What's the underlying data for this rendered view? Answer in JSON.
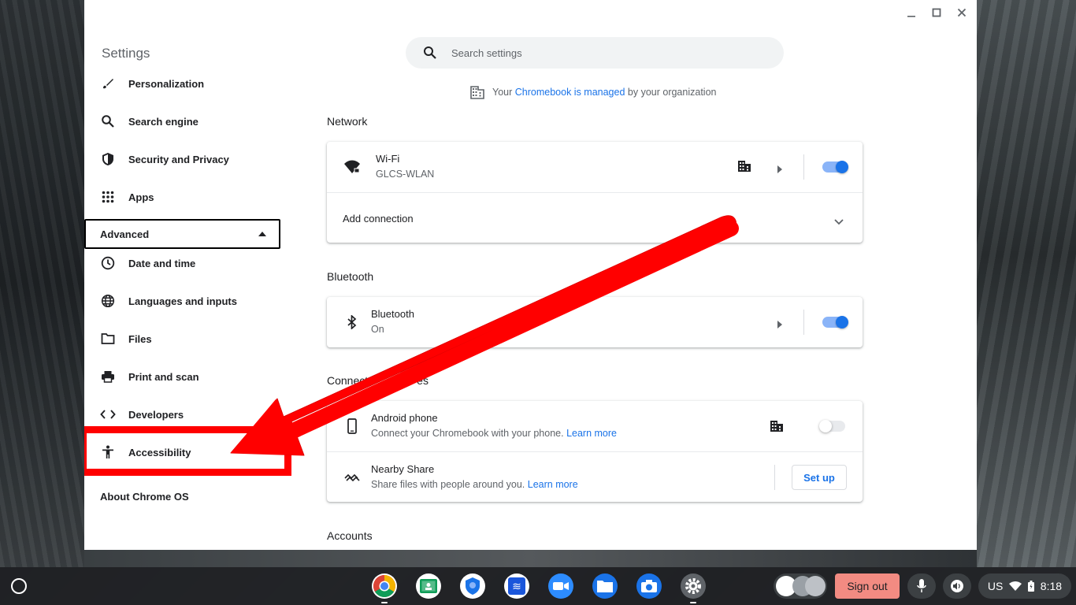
{
  "window": {
    "minimize_label": "–",
    "maximize_label": "□",
    "close_label": "×"
  },
  "sidebar": {
    "title": "Settings",
    "items": [
      {
        "label": "Personalization",
        "icon": "brush-icon"
      },
      {
        "label": "Search engine",
        "icon": "search-icon"
      },
      {
        "label": "Security and Privacy",
        "icon": "shield-icon"
      },
      {
        "label": "Apps",
        "icon": "apps-grid-icon"
      }
    ],
    "advanced_label": "Advanced",
    "advanced_items": [
      {
        "label": "Date and time",
        "icon": "clock-icon"
      },
      {
        "label": "Languages and inputs",
        "icon": "globe-icon"
      },
      {
        "label": "Files",
        "icon": "folder-icon"
      },
      {
        "label": "Print and scan",
        "icon": "printer-icon"
      },
      {
        "label": "Developers",
        "icon": "code-icon"
      },
      {
        "label": "Accessibility",
        "icon": "accessibility-icon"
      }
    ],
    "about_label": "About Chrome OS"
  },
  "search": {
    "placeholder": "Search settings"
  },
  "managed": {
    "prefix": "Your",
    "link": "Chromebook is managed",
    "suffix": "by your organization"
  },
  "network": {
    "section_title": "Network",
    "wifi_label": "Wi-Fi",
    "wifi_network": "GLCS-WLAN",
    "wifi_enabled": true,
    "add_connection_label": "Add connection"
  },
  "bluetooth": {
    "section_title": "Bluetooth",
    "label": "Bluetooth",
    "status": "On",
    "enabled": true
  },
  "connected_devices": {
    "section_title_visible": "Connect",
    "section_title_tail": "es",
    "android_label": "Android phone",
    "android_desc": "Connect your Chromebook with your phone.",
    "android_link": "Learn more",
    "android_enabled": false,
    "nearby_label": "Nearby Share",
    "nearby_desc": "Share files with people around you.",
    "nearby_link": "Learn more",
    "setup_label": "Set up"
  },
  "accounts": {
    "section_title": "Accounts"
  },
  "shelf": {
    "sign_out_label": "Sign out",
    "locale": "US",
    "time": "8:18",
    "apps": [
      "chrome-icon",
      "classroom-icon",
      "security-app-icon",
      "docs-app-icon",
      "zoom-icon",
      "files-icon",
      "camera-icon",
      "settings-gear-icon"
    ]
  },
  "colors": {
    "accent": "#1a73e8",
    "highlight": "#ff0000",
    "sign_out": "#f28b82"
  }
}
